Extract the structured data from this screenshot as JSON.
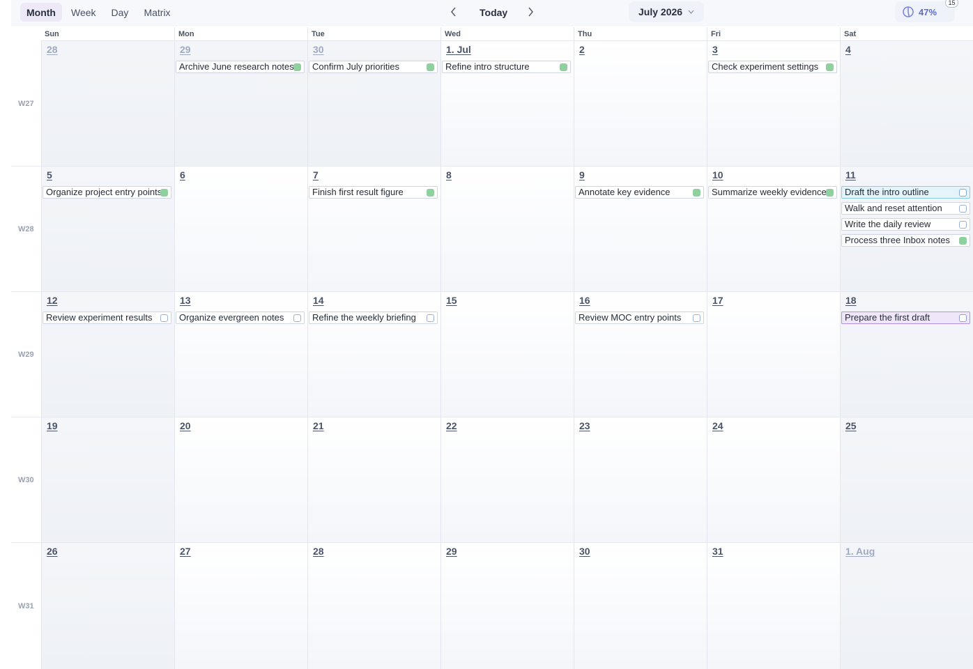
{
  "toolbar": {
    "views": [
      "Month",
      "Week",
      "Day",
      "Matrix"
    ],
    "active_view": "Month",
    "prev_icon": "chevron-left-icon",
    "today_label": "Today",
    "next_icon": "chevron-right-icon",
    "month_label": "July 2026",
    "progress_percent": "47%",
    "progress_value": 0.47,
    "progress_badge": "15"
  },
  "weekdays": [
    "Sun",
    "Mon",
    "Tue",
    "Wed",
    "Thu",
    "Fri",
    "Sat"
  ],
  "colors": {
    "accent": "#5b6bd0",
    "done": "#8fd19e",
    "highlight_blue": "#e4f4fa",
    "highlight_purple": "#efe6fa"
  },
  "weeks": [
    {
      "label": "W27",
      "days": [
        {
          "num": "28",
          "outside": true,
          "tasks": []
        },
        {
          "num": "29",
          "outside": true,
          "tasks": [
            {
              "title": "Archive June research notes",
              "done": true
            }
          ]
        },
        {
          "num": "30",
          "outside": true,
          "tasks": [
            {
              "title": "Confirm July priorities",
              "done": true
            }
          ]
        },
        {
          "num": "1. Jul",
          "tasks": [
            {
              "title": "Refine intro structure",
              "done": true
            }
          ]
        },
        {
          "num": "2",
          "tasks": []
        },
        {
          "num": "3",
          "tasks": [
            {
              "title": "Check experiment settings",
              "done": true
            }
          ]
        },
        {
          "num": "4",
          "tasks": []
        }
      ]
    },
    {
      "label": "W28",
      "days": [
        {
          "num": "5",
          "tasks": [
            {
              "title": "Organize project entry points",
              "done": true
            }
          ]
        },
        {
          "num": "6",
          "tasks": []
        },
        {
          "num": "7",
          "tasks": [
            {
              "title": "Finish first result figure",
              "done": true
            }
          ]
        },
        {
          "num": "8",
          "tasks": []
        },
        {
          "num": "9",
          "tasks": [
            {
              "title": "Annotate key evidence",
              "done": true
            }
          ]
        },
        {
          "num": "10",
          "tasks": [
            {
              "title": "Summarize weekly evidence",
              "done": true
            }
          ]
        },
        {
          "num": "11",
          "tasks": [
            {
              "title": "Draft the intro outline",
              "done": false,
              "highlight": "blue"
            },
            {
              "title": "Walk and reset attention",
              "done": false
            },
            {
              "title": "Write the daily review",
              "done": false
            },
            {
              "title": "Process three Inbox notes",
              "done": true
            }
          ]
        }
      ]
    },
    {
      "label": "W29",
      "days": [
        {
          "num": "12",
          "tasks": [
            {
              "title": "Review experiment results",
              "done": false
            }
          ]
        },
        {
          "num": "13",
          "tasks": [
            {
              "title": "Organize evergreen notes",
              "done": false
            }
          ]
        },
        {
          "num": "14",
          "tasks": [
            {
              "title": "Refine the weekly briefing",
              "done": false
            }
          ]
        },
        {
          "num": "15",
          "tasks": []
        },
        {
          "num": "16",
          "tasks": [
            {
              "title": "Review MOC entry points",
              "done": false
            }
          ]
        },
        {
          "num": "17",
          "tasks": []
        },
        {
          "num": "18",
          "tasks": [
            {
              "title": "Prepare the first draft",
              "done": false,
              "highlight": "purple"
            }
          ]
        }
      ]
    },
    {
      "label": "W30",
      "days": [
        {
          "num": "19",
          "tasks": []
        },
        {
          "num": "20",
          "tasks": []
        },
        {
          "num": "21",
          "tasks": []
        },
        {
          "num": "22",
          "tasks": []
        },
        {
          "num": "23",
          "tasks": []
        },
        {
          "num": "24",
          "tasks": []
        },
        {
          "num": "25",
          "tasks": []
        }
      ]
    },
    {
      "label": "W31",
      "days": [
        {
          "num": "26",
          "tasks": []
        },
        {
          "num": "27",
          "tasks": []
        },
        {
          "num": "28",
          "tasks": []
        },
        {
          "num": "29",
          "tasks": []
        },
        {
          "num": "30",
          "tasks": []
        },
        {
          "num": "31",
          "tasks": []
        },
        {
          "num": "1. Aug",
          "outside": true,
          "muted": true,
          "tasks": []
        }
      ]
    }
  ]
}
